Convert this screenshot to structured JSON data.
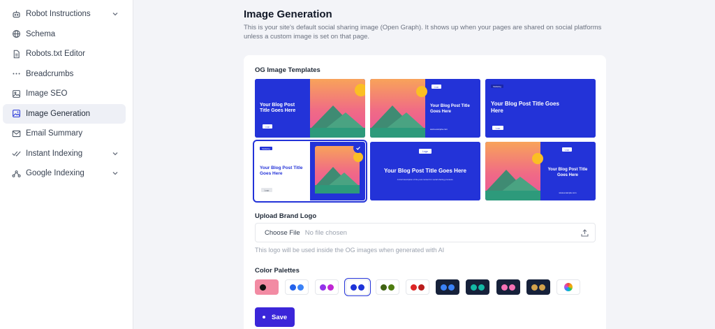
{
  "sidebar": {
    "items": [
      {
        "label": "Robot Instructions",
        "icon": "robot-icon",
        "chevron": true
      },
      {
        "label": "Schema",
        "icon": "globe-icon"
      },
      {
        "label": "Robots.txt Editor",
        "icon": "document-icon"
      },
      {
        "label": "Breadcrumbs",
        "icon": "dots-icon"
      },
      {
        "label": "Image SEO",
        "icon": "image-icon"
      },
      {
        "label": "Image Generation",
        "icon": "image-sparkle-icon",
        "active": true
      },
      {
        "label": "Email Summary",
        "icon": "mail-icon"
      },
      {
        "label": "Instant Indexing",
        "icon": "check-double-icon",
        "chevron": true
      },
      {
        "label": "Google Indexing",
        "icon": "network-icon",
        "chevron": true
      }
    ]
  },
  "header": {
    "title": "Image Generation",
    "description": "This is your site's default social sharing image (Open Graph). It shows up when your pages are shared on social platforms unless a custom image is set on that page."
  },
  "templates": {
    "label": "OG Image Templates",
    "selected_index": 3,
    "items": [
      {
        "title_line1": "Your Blog Post",
        "title_line2": "Title Goes Here",
        "logo": "Logo"
      },
      {
        "title_line1": "Your Blog Post Title",
        "title_line2": "Goes Here",
        "logo": "Logo",
        "url": "www.example.com"
      },
      {
        "title_line1": "Your Blog Post Title Goes",
        "title_line2": "Here",
        "logo": "Logo",
        "tag": "Marketing"
      },
      {
        "title_line1": "Your Blog Post Title",
        "title_line2": "Goes Here",
        "logo": "Logo",
        "tag": "Marketing"
      },
      {
        "title_line1": "Your Blog Post Title Goes Here",
        "title_line2": "",
        "logo": "Logo",
        "subtitle": "A brief description of the post content for social sharing previews."
      },
      {
        "title_line1": "Your Blog Post Title",
        "title_line2": "Goes Here",
        "logo": "Logo",
        "url": "www.example.com"
      }
    ]
  },
  "upload": {
    "label": "Upload Brand Logo",
    "button": "Choose File",
    "status": "No file chosen",
    "hint": "This logo will be used inside the OG images when generated with AI"
  },
  "palettes": {
    "label": "Color Palettes",
    "selected_index": 3,
    "items": [
      {
        "bg": "pink",
        "colors": [
          "#111111",
          "#f28ba3"
        ]
      },
      {
        "bg": "light",
        "colors": [
          "#2563eb",
          "#3b82f6"
        ]
      },
      {
        "bg": "light",
        "colors": [
          "#9333ea",
          "#c026d3"
        ]
      },
      {
        "bg": "light",
        "colors": [
          "#1d33d8",
          "#1d33d8"
        ]
      },
      {
        "bg": "light",
        "colors": [
          "#3f6212",
          "#4d7c0f"
        ]
      },
      {
        "bg": "light",
        "colors": [
          "#dc2626",
          "#b91c1c"
        ]
      },
      {
        "bg": "dark",
        "colors": [
          "#3b82f6",
          "#3b82f6"
        ]
      },
      {
        "bg": "dark",
        "colors": [
          "#14b8a6",
          "#14b8a6"
        ]
      },
      {
        "bg": "dark",
        "colors": [
          "#f472b6",
          "#f472b6"
        ]
      },
      {
        "bg": "dark",
        "colors": [
          "#d4a24c",
          "#d4a24c"
        ]
      },
      {
        "bg": "light",
        "colors": [
          "rainbow"
        ]
      }
    ]
  },
  "actions": {
    "save_label": "Save"
  },
  "colors": {
    "accent": "#2333d8",
    "save": "#3b26d9"
  }
}
